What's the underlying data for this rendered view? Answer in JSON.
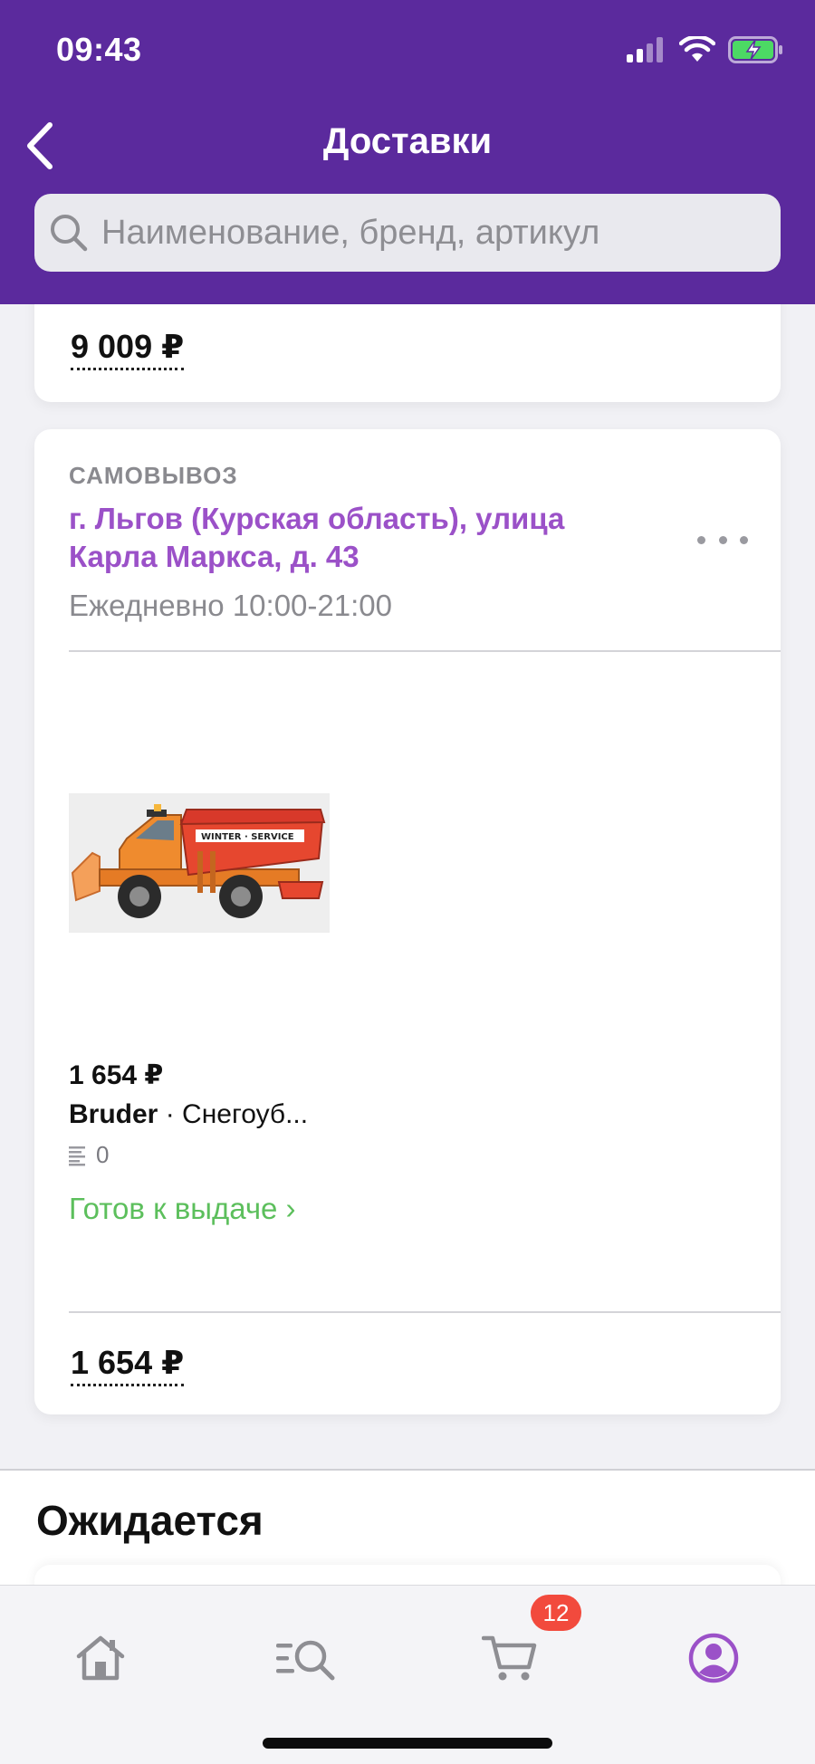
{
  "status_bar": {
    "time": "09:43"
  },
  "header": {
    "title": "Доставки",
    "search_placeholder": "Наименование, бренд, артикул"
  },
  "previous_card": {
    "total": "9 009 ₽"
  },
  "pickup_card": {
    "label": "САМОВЫВОЗ",
    "address": "г. Льгов (Курская область), улица Карла Маркса, д. 43",
    "hours": "Ежедневно 10:00-21:00",
    "product": {
      "price": "1 654 ₽",
      "brand": "Bruder",
      "separator": " · ",
      "name": "Снегоуб...",
      "reviews": "0",
      "image_text": "WINTER · SERVICE"
    },
    "status": "Готов к выдаче ›",
    "total": "1 654 ₽"
  },
  "expected_section": {
    "title": "Ожидается"
  },
  "tab_bar": {
    "cart_badge": "12",
    "accent": "#9b51c8"
  },
  "colors": {
    "header": "#5b2a9d",
    "address": "#9b51c8",
    "ready": "#5cbf5c",
    "badge": "#f24a3d"
  }
}
